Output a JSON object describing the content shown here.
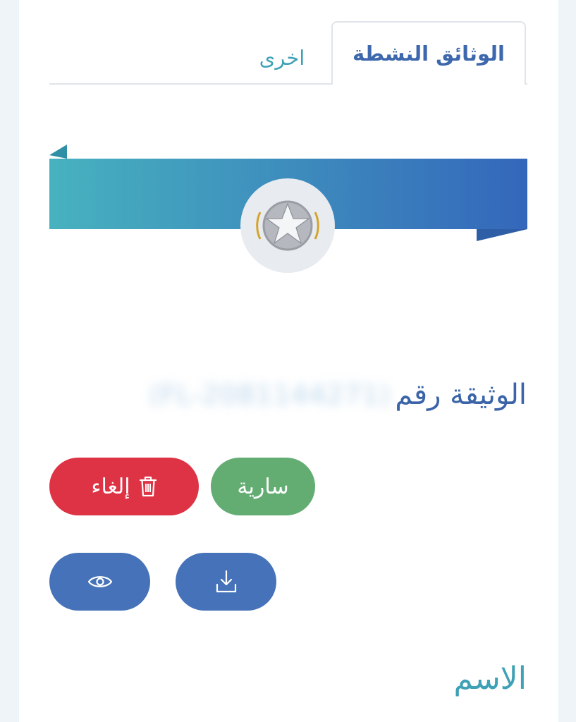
{
  "tabs": {
    "active": "الوثائق النشطة",
    "other": "اخرى"
  },
  "badge": {
    "icon": "star-icon"
  },
  "document": {
    "label": "الوثيقة رقم",
    "number": "(FL-2081144271)"
  },
  "actions": {
    "status_label": "سارية",
    "cancel_label": "إلغاء",
    "cancel_icon": "trash-icon",
    "download_icon": "download-icon",
    "view_icon": "eye-icon"
  },
  "fields": {
    "name_label": "الاسم"
  },
  "colors": {
    "primary": "#3e68ad",
    "teal": "#3fa1b6",
    "success": "#63ad73",
    "danger": "#dd3345",
    "button": "#4572b8"
  }
}
